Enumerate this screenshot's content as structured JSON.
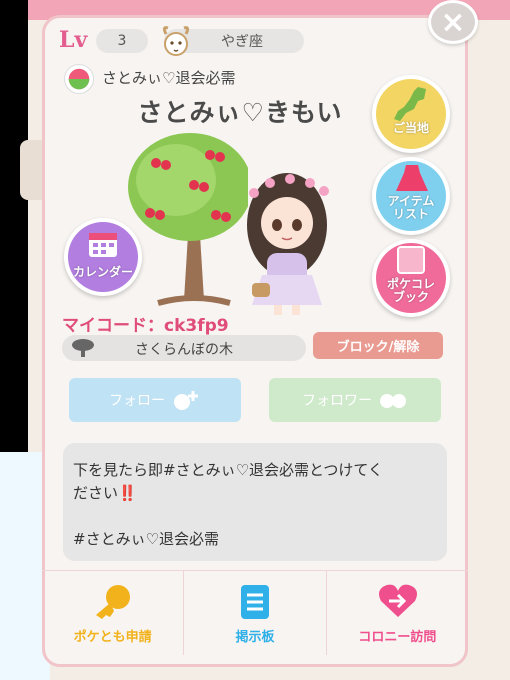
{
  "profile": {
    "level_label": "Lv",
    "level": "3",
    "zodiac": "やぎ座",
    "sub_name": "さとみぃ♡退会必需",
    "name": "さとみぃ♡きもい",
    "my_code_label": "マイコード：",
    "my_code": "ck3fp9",
    "tree_name": "さくらんぼの木"
  },
  "buttons": {
    "close": "×",
    "current_location": "ご当地",
    "item_list_line1": "アイテム",
    "item_list_line2": "リスト",
    "calendar": "カレンダー",
    "pokecolle_line1": "ポケコレ",
    "pokecolle_line2": "ブック",
    "block": "ブロック/解除",
    "follow": "フォロー",
    "follower": "フォロワー"
  },
  "message": {
    "line1": "下を見たら即#さとみぃ♡退会必需とつけてく",
    "line2": "ださい",
    "line2_emoji": "‼️",
    "line3": "#さとみぃ♡退会必需"
  },
  "bottom_nav": [
    {
      "label": "ポケとも申請",
      "icon": "key-icon",
      "color": "#f2b21b"
    },
    {
      "label": "掲示板",
      "icon": "board-icon",
      "color": "#2fb0e8"
    },
    {
      "label": "コロニー訪問",
      "icon": "visit-icon",
      "color": "#ef4f8c"
    }
  ],
  "colors": {
    "accent_pink": "#e04d7a",
    "follow_blue": "#bfe2f4",
    "follower_green": "#cfeacb",
    "block_salmon": "#e99a91"
  }
}
